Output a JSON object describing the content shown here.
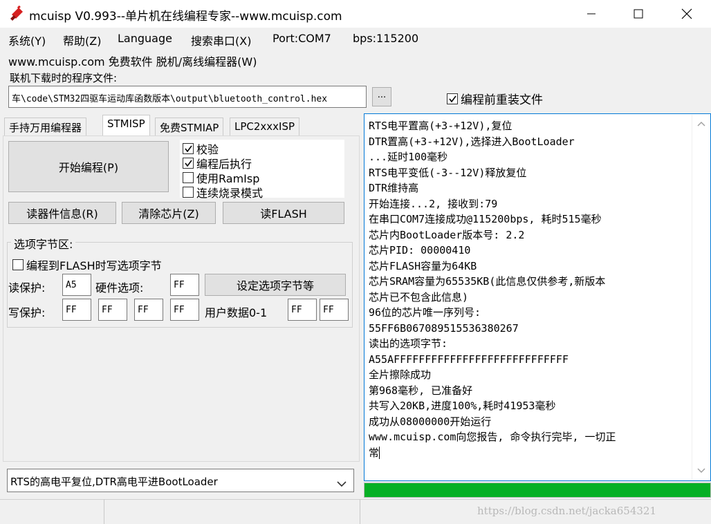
{
  "window": {
    "title": "mcuisp V0.993--单片机在线编程专家--www.mcuisp.com",
    "icon": "red-chip-icon"
  },
  "menu": {
    "row1": [
      "系统(Y)",
      "帮助(Z)",
      "Language",
      "搜索串口(X)",
      "Port:COM7",
      "bps:115200"
    ],
    "row2": [
      "www.mcuisp.com 免费软件 脱机/离线编程器(W)"
    ]
  },
  "file": {
    "label": "联机下载时的程序文件:",
    "path": "车\\code\\STM32四驱车运动库函数版本\\output\\bluetooth_control.hex",
    "browse": "...",
    "reload_label": "编程前重装文件",
    "reload_checked": true
  },
  "tabs": [
    {
      "label": "手持万用编程器",
      "active": false
    },
    {
      "label": "STMISP",
      "active": true
    },
    {
      "label": "免费STMIAP",
      "active": false
    },
    {
      "label": "LPC2xxxISP",
      "active": false
    }
  ],
  "stmisp": {
    "start_button": "开始编程(P)",
    "options": [
      {
        "label": "校验",
        "checked": true
      },
      {
        "label": "编程后执行",
        "checked": true
      },
      {
        "label": "使用RamIsp",
        "checked": false
      },
      {
        "label": "连续烧录模式",
        "checked": false
      }
    ],
    "read_info_button": "读器件信息(R)",
    "erase_button": "清除芯片(Z)",
    "read_flash_button": "读FLASH",
    "option_bytes": {
      "group_label": "选项字节区:",
      "write_option_label": "编程到FLASH时写选项字节",
      "write_option_checked": false,
      "read_protect_label": "读保护:",
      "read_protect_value": "A5",
      "hw_option_label": "硬件选项:",
      "hw_option_value": "FF",
      "set_button": "设定选项字节等",
      "write_protect_label": "写保护:",
      "write_protect_values": [
        "FF",
        "FF",
        "FF",
        "FF"
      ],
      "user_data_label": "用户数据0-1",
      "user_data_values": [
        "FF",
        "FF"
      ]
    },
    "reset_mode": "RTS的高电平复位,DTR高电平进BootLoader"
  },
  "log": {
    "lines": [
      "RTS电平置高(+3-+12V),复位",
      "DTR置高(+3-+12V),选择进入BootLoader",
      "...延时100毫秒",
      "RTS电平变低(-3--12V)释放复位",
      "DTR维持高",
      "开始连接...2, 接收到:79",
      "在串口COM7连接成功@115200bps, 耗时515毫秒",
      "芯片内BootLoader版本号: 2.2",
      "芯片PID: 00000410",
      "芯片FLASH容量为64KB",
      "芯片SRAM容量为65535KB(此信息仅供参考,新版本",
      "芯片已不包含此信息)",
      "96位的芯片唯一序列号:",
      "55FF6B067089515536380267",
      "读出的选项字节:",
      "A55AFFFFFFFFFFFFFFFFFFFFFFFFFFFF",
      "全片擦除成功",
      "第968毫秒, 已准备好",
      "共写入20KB,进度100%,耗时41953毫秒",
      "成功从08000000开始运行",
      "www.mcuisp.com向您报告, 命令执行完毕, 一切正",
      "常"
    ],
    "progress": 1.0
  },
  "watermark": "https://blog.csdn.net/jacka654321",
  "colors": {
    "progress": "#06b025",
    "focus_border": "#0078d7",
    "icon_red": "#d62020"
  }
}
